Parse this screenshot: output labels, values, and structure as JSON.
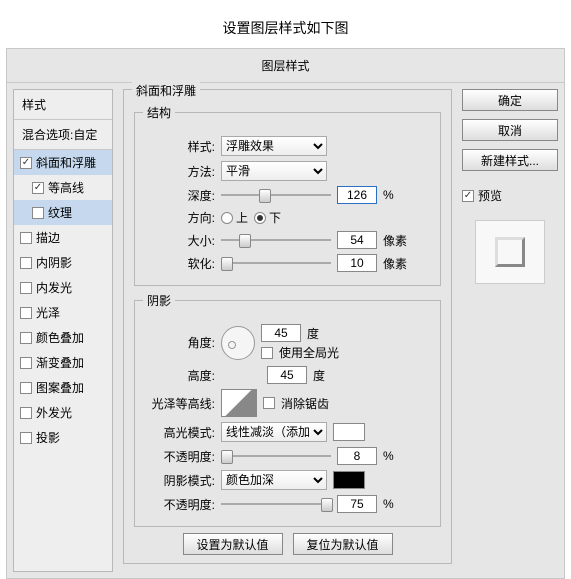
{
  "page_title": "设置图层样式如下图",
  "dialog_title": "图层样式",
  "styles": {
    "header": "样式",
    "blend": "混合选项:自定",
    "items": [
      {
        "label": "斜面和浮雕",
        "checked": true,
        "sel": true
      },
      {
        "label": "等高线",
        "checked": true,
        "indent": true
      },
      {
        "label": "纹理",
        "checked": false,
        "indent": true,
        "sel": true
      },
      {
        "label": "描边",
        "checked": false
      },
      {
        "label": "内阴影",
        "checked": false
      },
      {
        "label": "内发光",
        "checked": false
      },
      {
        "label": "光泽",
        "checked": false
      },
      {
        "label": "颜色叠加",
        "checked": false
      },
      {
        "label": "渐变叠加",
        "checked": false
      },
      {
        "label": "图案叠加",
        "checked": false
      },
      {
        "label": "外发光",
        "checked": false
      },
      {
        "label": "投影",
        "checked": false
      }
    ]
  },
  "main": {
    "title": "斜面和浮雕",
    "struct": {
      "legend": "结构",
      "style_lbl": "样式:",
      "style_val": "浮雕效果",
      "tech_lbl": "方法:",
      "tech_val": "平滑",
      "depth_lbl": "深度:",
      "depth_val": "126",
      "depth_unit": "%",
      "dir_lbl": "方向:",
      "dir_up": "上",
      "dir_down": "下",
      "size_lbl": "大小:",
      "size_val": "54",
      "size_unit": "像素",
      "soften_lbl": "软化:",
      "soften_val": "10",
      "soften_unit": "像素"
    },
    "shade": {
      "legend": "阴影",
      "angle_lbl": "角度:",
      "angle_val": "45",
      "angle_unit": "度",
      "global": "使用全局光",
      "alt_lbl": "高度:",
      "alt_val": "45",
      "alt_unit": "度",
      "gloss_lbl": "光泽等高线:",
      "anti": "消除锯齿",
      "hi_lbl": "高光模式:",
      "hi_val": "线性减淡（添加）",
      "hi_color": "#ffffff",
      "hi_op_lbl": "不透明度:",
      "hi_op_val": "8",
      "hi_op_unit": "%",
      "sh_lbl": "阴影模式:",
      "sh_val": "颜色加深",
      "sh_color": "#000000",
      "sh_op_lbl": "不透明度:",
      "sh_op_val": "75",
      "sh_op_unit": "%"
    },
    "make_default": "设置为默认值",
    "reset_default": "复位为默认值"
  },
  "buttons": {
    "ok": "确定",
    "cancel": "取消",
    "new_style": "新建样式...",
    "preview": "预览"
  }
}
